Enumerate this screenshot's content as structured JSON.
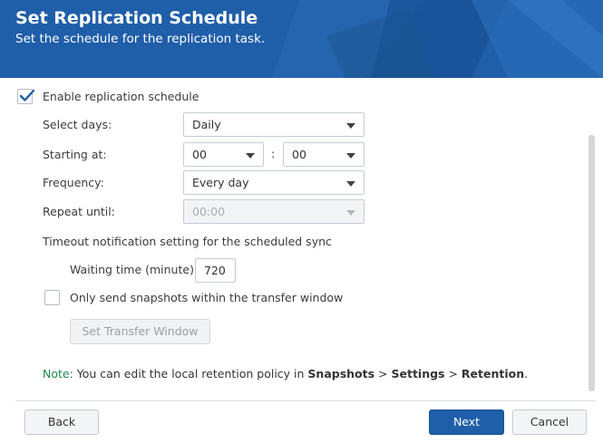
{
  "header": {
    "title": "Set Replication Schedule",
    "subtitle": "Set the schedule for the replication task."
  },
  "form": {
    "enable_label": "Enable replication schedule",
    "enable_checked": true,
    "select_days_label": "Select days:",
    "select_days_value": "Daily",
    "starting_at_label": "Starting at:",
    "starting_hour": "00",
    "time_separator": ":",
    "starting_minute": "00",
    "frequency_label": "Frequency:",
    "frequency_value": "Every day",
    "repeat_until_label": "Repeat until:",
    "repeat_until_value": "00:00",
    "timeout_heading": "Timeout notification setting for the scheduled sync",
    "waiting_time_label": "Waiting time (minute)",
    "waiting_time_value": "720",
    "snapshots_label": "Only send snapshots within the transfer window",
    "snapshots_checked": false,
    "transfer_window_button": "Set Transfer Window"
  },
  "note": {
    "prefix": "Note:",
    "text": " You can edit the local retention policy in ",
    "snapshots": "Snapshots",
    "sep1": " > ",
    "settings": "Settings",
    "sep2": " > ",
    "retention": "Retention",
    "end": "."
  },
  "footer": {
    "back": "Back",
    "next": "Next",
    "cancel": "Cancel"
  },
  "colors": {
    "header_bg": "#1f5ea8",
    "primary_button": "#1f5ea8",
    "note_accent": "#22894d",
    "checkmark": "#1f5ea8"
  }
}
